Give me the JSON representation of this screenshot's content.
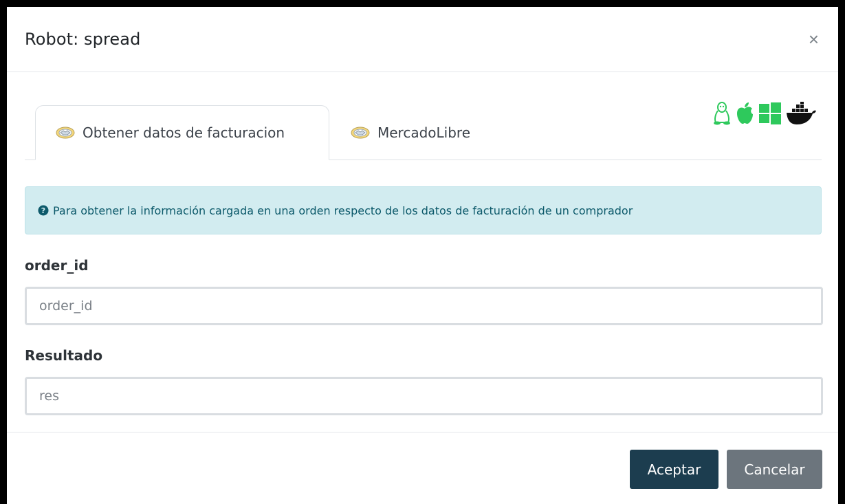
{
  "modal": {
    "title": "Robot: spread",
    "close_label": "×"
  },
  "tabs": [
    {
      "label": "Obtener datos de facturacion",
      "icon": "handshake-icon",
      "active": true
    },
    {
      "label": "MercadoLibre",
      "icon": "handshake-icon",
      "active": false
    }
  ],
  "os_icons": [
    "linux-icon",
    "apple-icon",
    "windows-icon",
    "docker-icon"
  ],
  "colors": {
    "os_green": "#2ec95c",
    "docker_black": "#111111",
    "primary_button": "#1c3d4f",
    "secondary_button": "#6c757d",
    "info_bg": "#d2ecf0"
  },
  "info": {
    "text": "Para obtener la información cargada en una orden respecto de los datos de facturación de un comprador"
  },
  "fields": {
    "order_id": {
      "label": "order_id",
      "placeholder": "order_id",
      "value": ""
    },
    "result": {
      "label": "Resultado",
      "placeholder": "res",
      "value": ""
    }
  },
  "footer": {
    "accept_label": "Aceptar",
    "cancel_label": "Cancelar"
  }
}
